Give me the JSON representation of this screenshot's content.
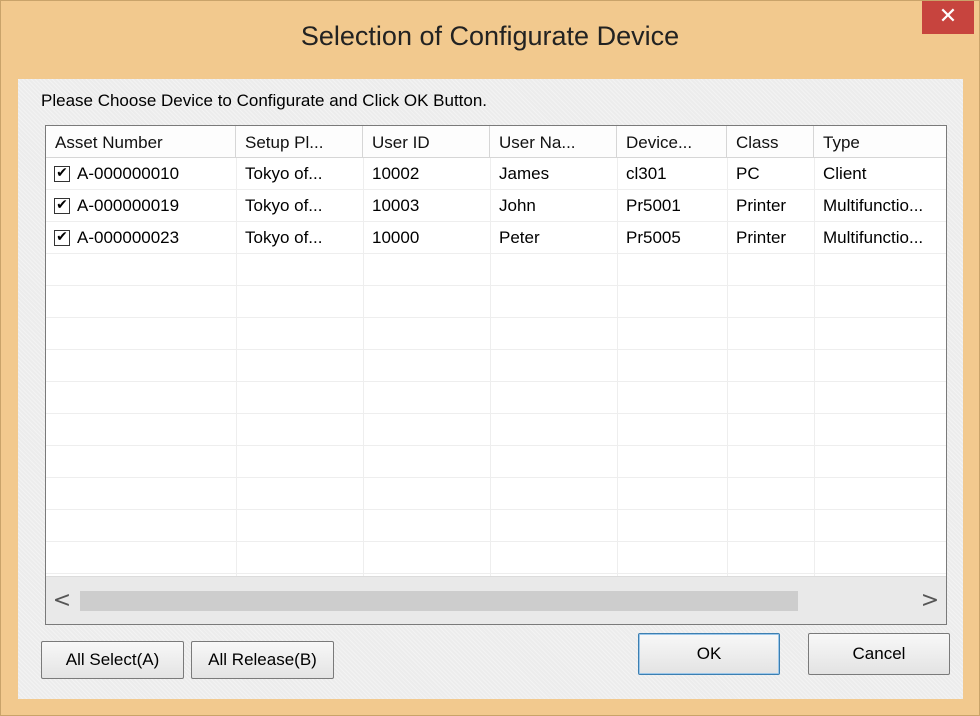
{
  "window": {
    "title": "Selection of Configurate Device",
    "close_label": "✕"
  },
  "instruction": "Please Choose Device to Configurate and Click OK Button.",
  "table": {
    "columns": [
      "Asset Number",
      "Setup Pl...",
      "User ID",
      "User Na...",
      "Device...",
      "Class",
      "Type"
    ],
    "rows": [
      {
        "checked": true,
        "cells": [
          "A-000000010",
          "Tokyo of...",
          "10002",
          "James",
          "cl301",
          "PC",
          "Client"
        ]
      },
      {
        "checked": true,
        "cells": [
          "A-000000019",
          "Tokyo of...",
          "10003",
          "John",
          "Pr5001",
          "Printer",
          "Multifunctio..."
        ]
      },
      {
        "checked": true,
        "cells": [
          "A-000000023",
          "Tokyo of...",
          "10000",
          "Peter",
          "Pr5005",
          "Printer",
          "Multifunctio..."
        ]
      }
    ],
    "check_glyph": "✔"
  },
  "scrollbar": {
    "left_arrow": "<",
    "right_arrow": ">"
  },
  "buttons": {
    "all_select": "All Select(A)",
    "all_release": "All Release(B)",
    "ok": "OK",
    "cancel": "Cancel"
  },
  "colors": {
    "titlebar": "#f2c98e",
    "close": "#c7443e",
    "ok_border": "#3c7fb1"
  }
}
